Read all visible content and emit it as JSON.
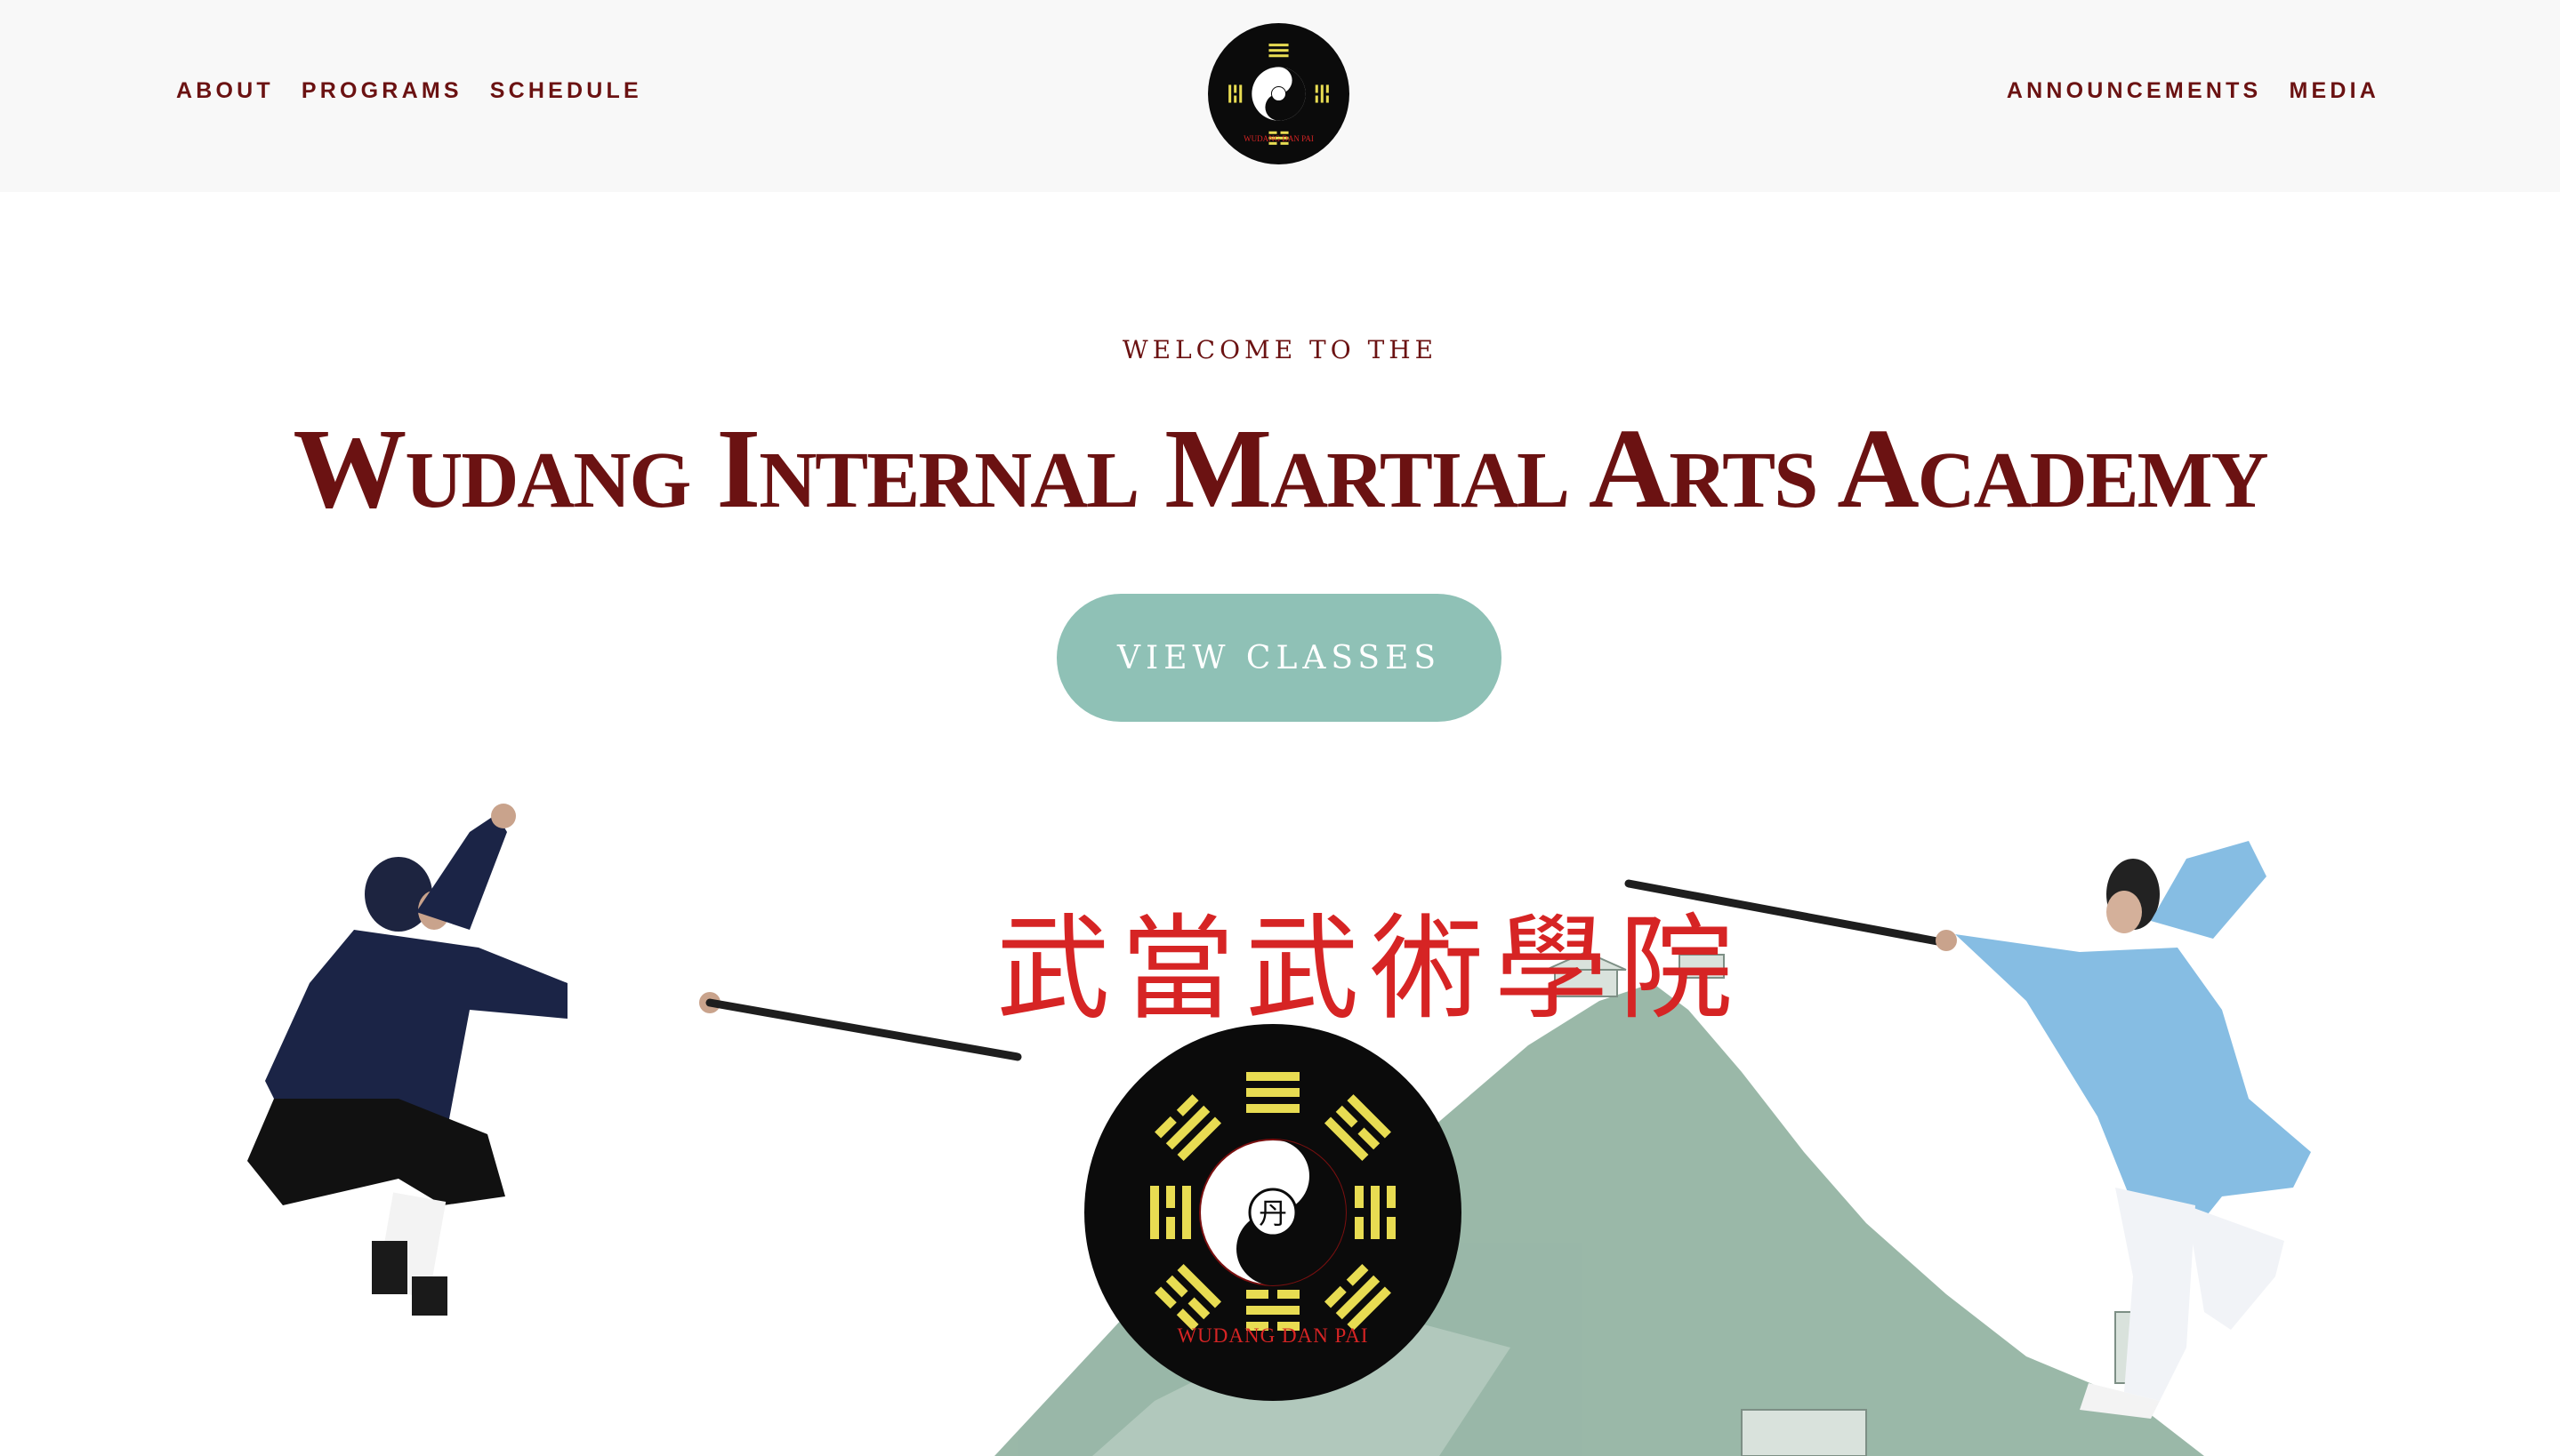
{
  "nav": {
    "left": [
      "ABOUT",
      "PROGRAMS",
      "SCHEDULE"
    ],
    "right": [
      "ANNOUNCEMENTS",
      "MEDIA"
    ]
  },
  "logo": {
    "caption": "WUDANG DAN PAI",
    "center_glyph": "丹"
  },
  "hero": {
    "welcome": "WELCOME TO THE",
    "title": "Wudang Internal Martial Arts Academy",
    "cta": "VIEW CLASSES",
    "calligraphy": "武當武術學院"
  },
  "colors": {
    "brand": "#6b1212",
    "button": "#8fc1b6",
    "calligraphy": "#d62424",
    "trigram": "#e8dc52",
    "mountain": "#8fb09f"
  }
}
